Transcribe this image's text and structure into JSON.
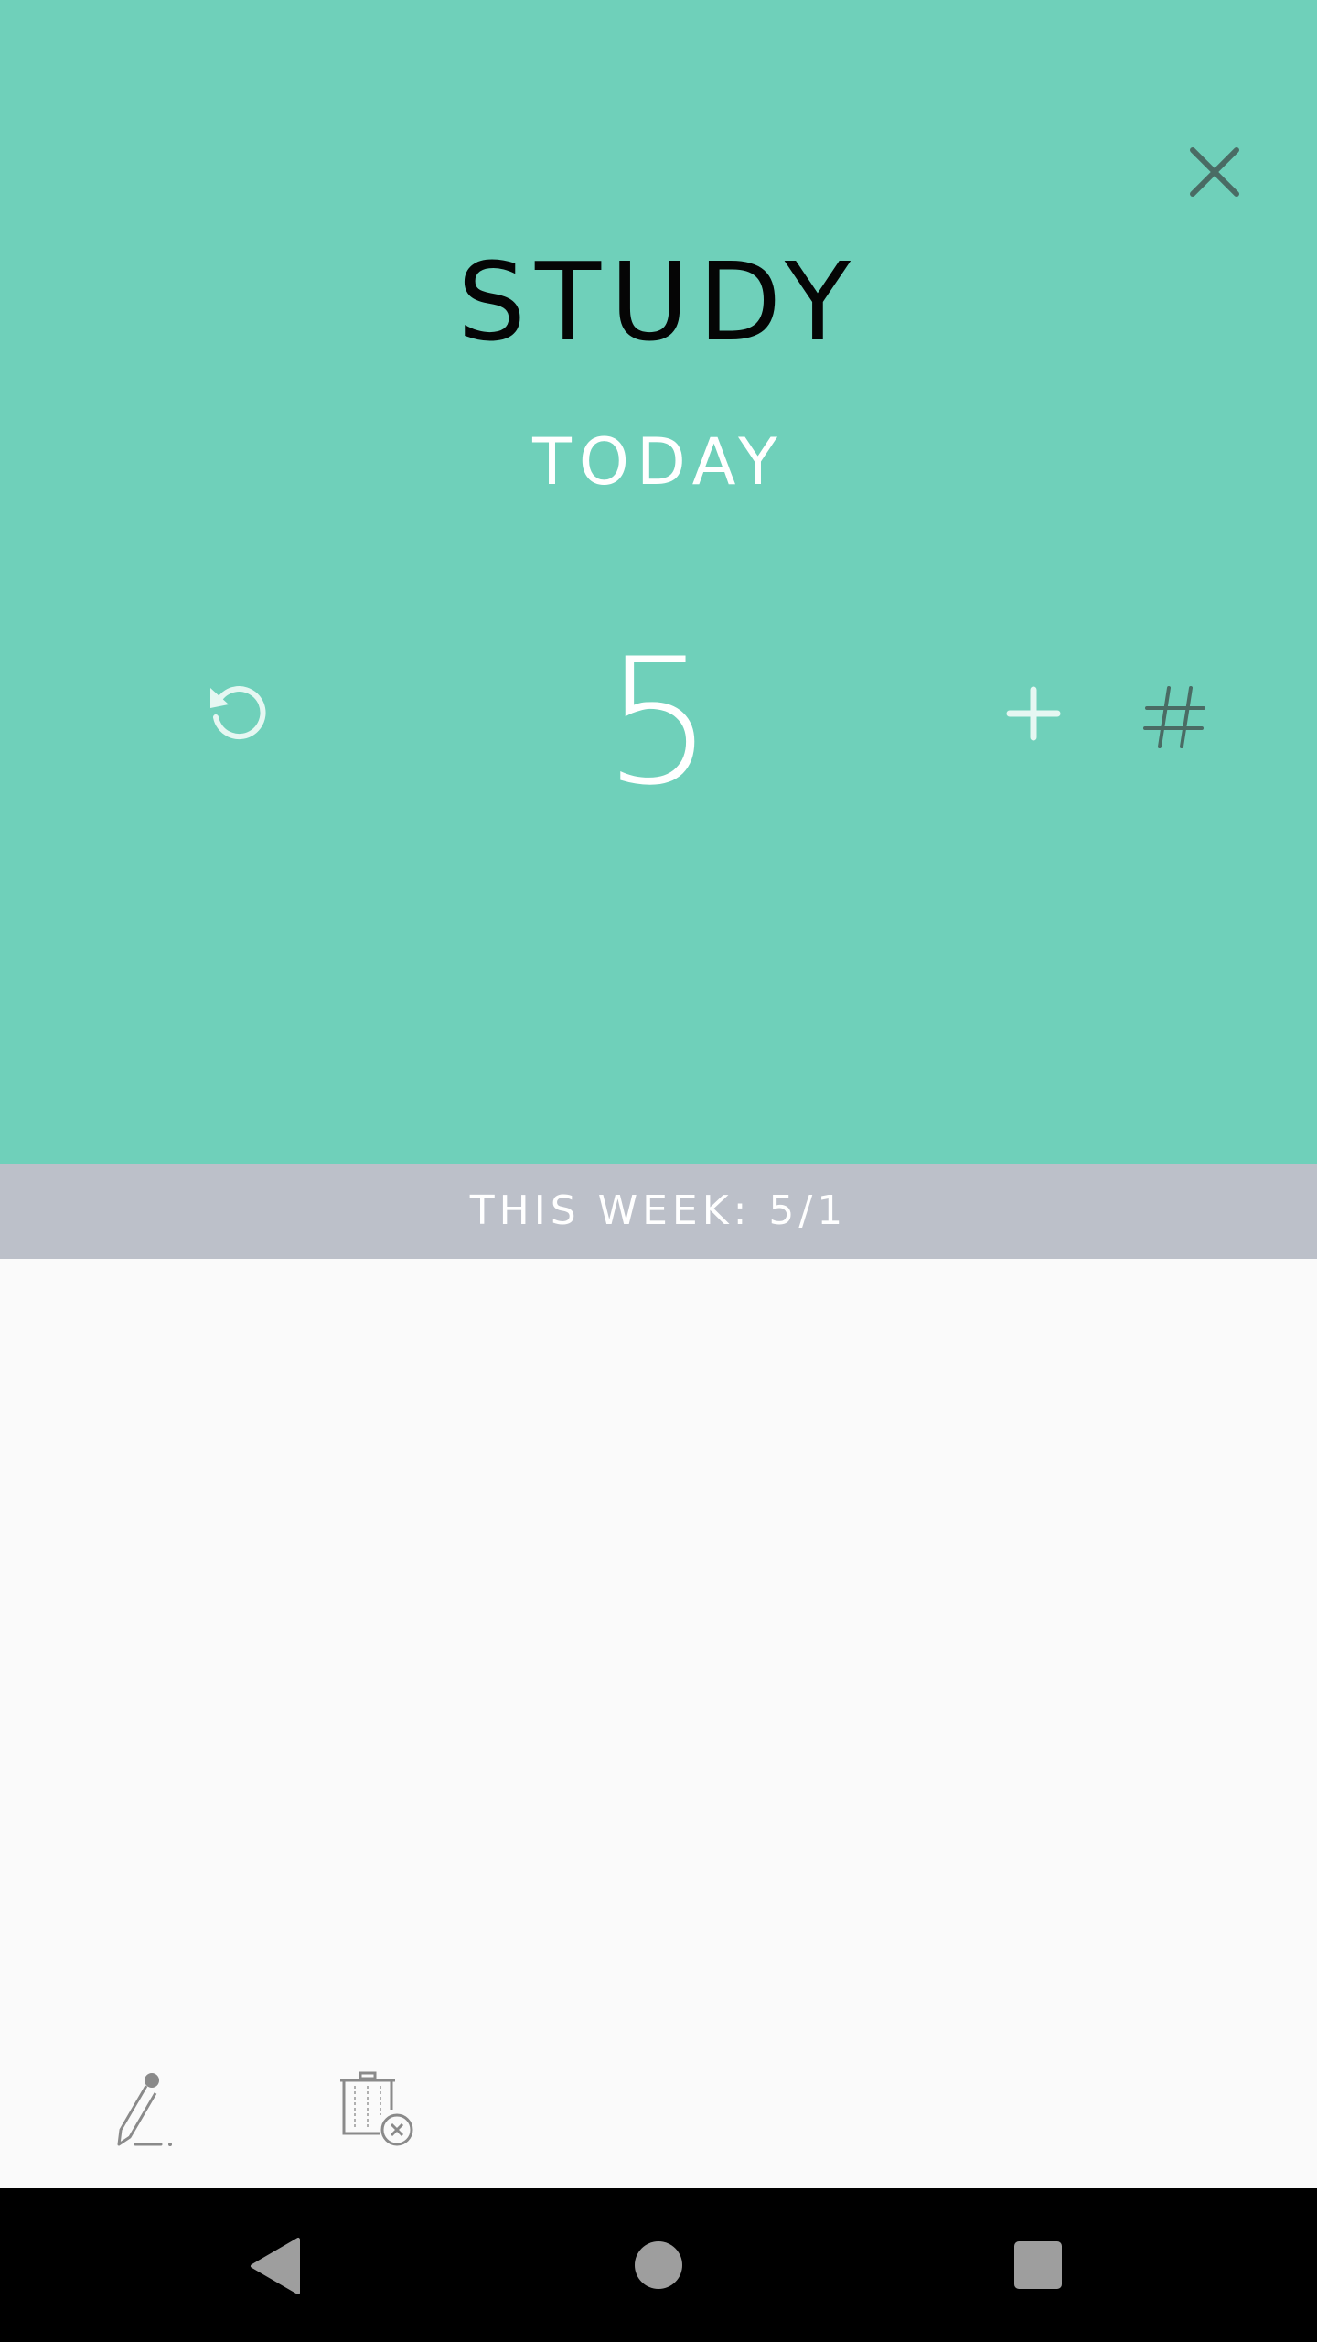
{
  "header": {
    "title": "STUDY",
    "period": "TODAY"
  },
  "counter": {
    "value": "5"
  },
  "week_summary": {
    "text": "THIS WEEK: 5/1"
  },
  "icons": {
    "close": "close-icon",
    "reset": "reset-icon",
    "add": "plus-icon",
    "set_number": "hash-icon",
    "edit": "pencil-icon",
    "delete": "trash-icon",
    "nav_back": "back-triangle-icon",
    "nav_home": "home-circle-icon",
    "nav_recents": "recents-square-icon"
  },
  "colors": {
    "accent": "#6fd0ba",
    "week_bar": "#bcc0c9",
    "background": "#fafafa",
    "nav_bar": "#000000"
  }
}
